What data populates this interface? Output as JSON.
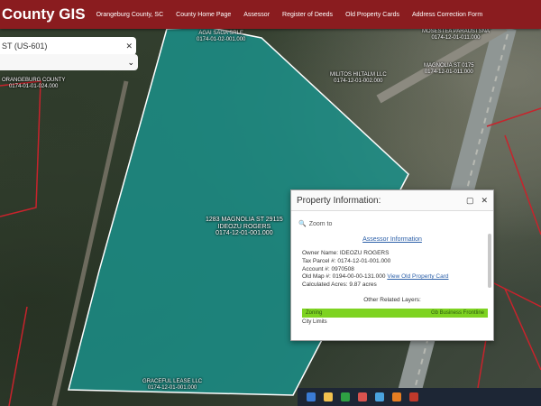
{
  "header": {
    "brand": "County GIS",
    "nav": [
      "Orangeburg County, SC",
      "County Home Page",
      "Assessor",
      "Register of Deeds",
      "Old Property Cards",
      "Address Correction Form"
    ]
  },
  "search": {
    "value": "ST (US-601)",
    "clear_glyph": "✕"
  },
  "layer_select": {
    "chevron_glyph": "⌄"
  },
  "map_labels": {
    "top": [
      "AGAI SAGA SRLE",
      "0174-01-02-001.000"
    ],
    "top_right_a": [
      "MOSESTEA PARAUSTSNA",
      "0174-12-01-011.000"
    ],
    "top_right_b": [
      "MAGNOLIA ST 0175",
      "0174-12-01-011.000"
    ],
    "right_mid": [
      "MILITOS HILTALM LLC",
      "0174-12-01-002.000"
    ],
    "left": [
      "ORANGEBURG COUNTY",
      "0174-01-01-024.000"
    ],
    "center": [
      "1283 MAGNOLIA ST 29115",
      "IDEOZU ROGERS",
      "0174-12-01-001.000"
    ],
    "bottom": [
      "GRACEFUL LEASE LLC",
      "0174-12-01-001.000"
    ]
  },
  "popup": {
    "title": "Property Information:",
    "zoom_label": "Zoom to",
    "assessor_link": "Assessor Information",
    "owner_line": "Owner Name: IDEOZU ROGERS",
    "parcel_line": "Tax Parcel #: 0174-12-01-001.000",
    "account_line": "Account #: 0970508",
    "oldmap_line": "Old Map #: 0194-00-00-131.000",
    "old_card_link": "View Old Property Card",
    "acres_line": "Calculated Acres: 9.87 acres",
    "related_title": "Other Related Layers:",
    "zoning_label": "Zoning",
    "zoning_value": "Gb Business Frontline",
    "city_label": "City Limits"
  },
  "colors": {
    "header_bg": "#8a1c1f",
    "parcel_fill": "#1b8f88",
    "parcel_boundary": "#ffffff",
    "parcel_lines": "#c8232c",
    "zoning_bg": "#7ed321"
  }
}
